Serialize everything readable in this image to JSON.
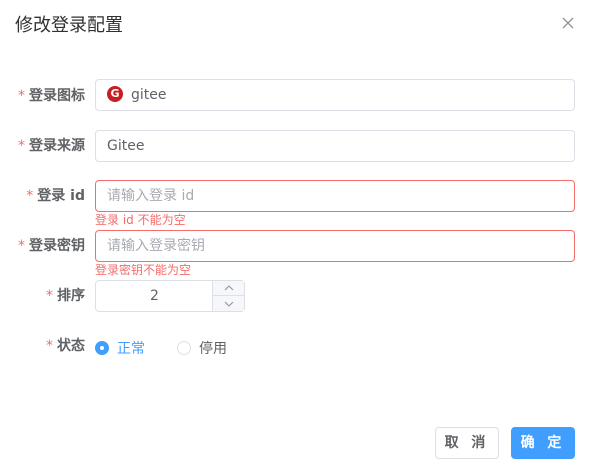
{
  "dialog": {
    "title": "修改登录配置",
    "close_icon": "close-icon"
  },
  "form": {
    "required_mark": "*",
    "icon_row": {
      "label": "登录图标",
      "value": "gitee",
      "icon": "gitee-logo-icon"
    },
    "source_row": {
      "label": "登录来源",
      "value": "Gitee"
    },
    "id_row": {
      "label": "登录 id",
      "placeholder": "请输入登录 id",
      "error": "登录 id 不能为空"
    },
    "secret_row": {
      "label": "登录密钥",
      "placeholder": "请输入登录密钥",
      "error": "登录密钥不能为空"
    },
    "sort_row": {
      "label": "排序",
      "value": "2"
    },
    "status_row": {
      "label": "状态",
      "options": [
        {
          "label": "正常",
          "checked": true
        },
        {
          "label": "停用",
          "checked": false
        }
      ]
    }
  },
  "footer": {
    "cancel_label": "取 消",
    "confirm_label": "确 定"
  },
  "colors": {
    "primary": "#409eff",
    "danger": "#f56c6c",
    "border": "#dcdfe6",
    "text": "#606266"
  }
}
